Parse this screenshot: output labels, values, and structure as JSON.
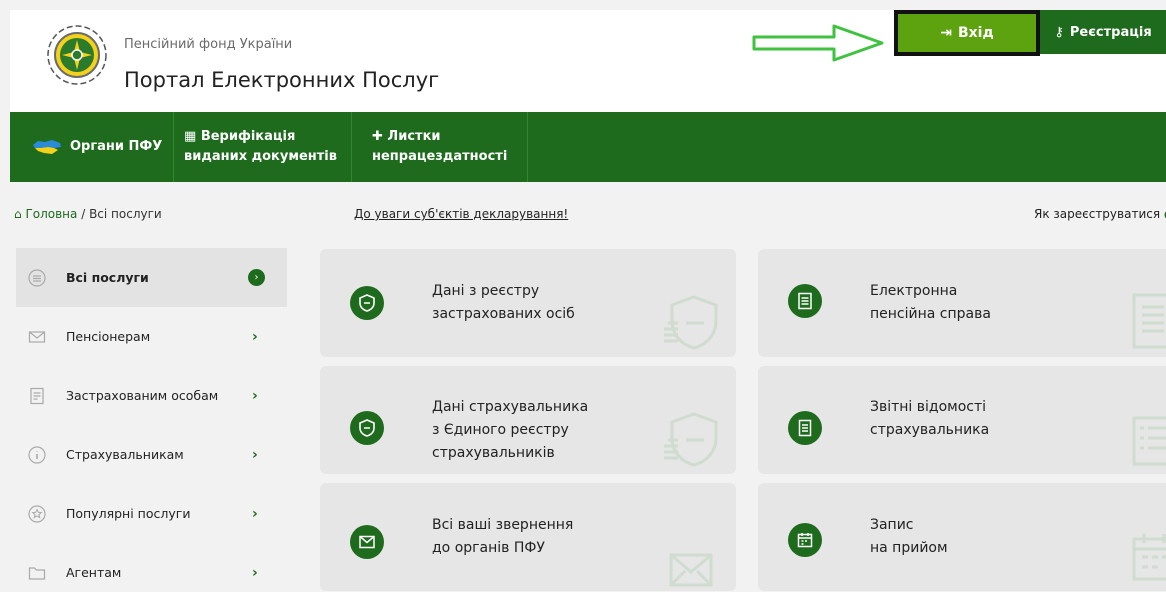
{
  "header": {
    "org_name": "Пенсійний фонд України",
    "portal_title": "Портал Електронних Послуг",
    "login_label": "Вхід",
    "register_label": "Реєстрація"
  },
  "nav": {
    "item1": "Органи ПФУ",
    "item2_line1": "Верифікація",
    "item2_line2": "виданих документів",
    "item3_line1": "Листки",
    "item3_line2": "непрацездатності"
  },
  "breadcrumb": {
    "home": "Головна",
    "separator": " / ",
    "current": "Всі послуги"
  },
  "notice_link": "До уваги суб'єктів декларування!",
  "howto_link": "Як зареєструватися",
  "sidebar": {
    "items": [
      {
        "label": "Всі послуги",
        "icon": "list-icon"
      },
      {
        "label": "Пенсіонерам",
        "icon": "envelope-icon"
      },
      {
        "label": "Застрахованим особам",
        "icon": "document-icon"
      },
      {
        "label": "Страхувальникам",
        "icon": "info-icon"
      },
      {
        "label": "Популярні послуги",
        "icon": "star-icon"
      },
      {
        "label": "Агентам",
        "icon": "folder-icon"
      }
    ]
  },
  "cards": [
    {
      "line1": "Дані з реєстру",
      "line2": "застрахованих осіб",
      "line3": "",
      "icon": "shield-icon"
    },
    {
      "line1": "Електронна",
      "line2": "пенсійна справа",
      "line3": "",
      "icon": "document-icon"
    },
    {
      "line1": "Дані страхувальника",
      "line2": "з Єдиного реєстру",
      "line3": "страхувальників",
      "icon": "shield-icon"
    },
    {
      "line1": "Звітні відомості",
      "line2": "страхувальника",
      "line3": "",
      "icon": "report-icon"
    },
    {
      "line1": "Всі ваші звернення",
      "line2": "до органів ПФУ",
      "line3": "",
      "icon": "envelope-icon"
    },
    {
      "line1": "Запис",
      "line2": "на прийом",
      "line3": "",
      "icon": "calendar-icon"
    }
  ],
  "colors": {
    "dark_green": "#1e6b1e",
    "light_green": "#5da30f",
    "card_bg": "#e6e6e6",
    "arrow_green": "#3fc23f"
  }
}
